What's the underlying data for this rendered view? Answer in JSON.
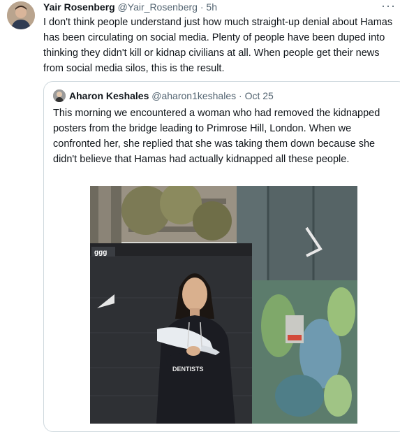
{
  "tweet": {
    "author_name": "Yair Rosenberg",
    "handle": "@Yair_Rosenberg",
    "separator": "·",
    "time": "5h",
    "more_icon": "more-horizontal-icon",
    "text": "I don't think people understand just how much straight-up denial about Hamas has been circulating on social media. Plenty of people have been duped into thinking they didn't kill or kidnap civilians at all. When people get their news from social media silos, this is the result."
  },
  "quoted": {
    "author_name": "Aharon Keshales",
    "handle": "@aharon1keshales",
    "separator": "·",
    "date": "Oct 25",
    "text": "This morning we encountered a woman who had removed the kidnapped posters from the bridge leading to Primrose Hill, London. When we confronted her, she replied that she was taking them down because she didn't believe that Hamas had actually kidnapped all these people.",
    "photo": {
      "sweatshirt_text": "DENTISTS",
      "sign_text": "ggg"
    }
  },
  "colors": {
    "text": "#0f1419",
    "muted": "#536471",
    "border": "#cfd9de"
  }
}
